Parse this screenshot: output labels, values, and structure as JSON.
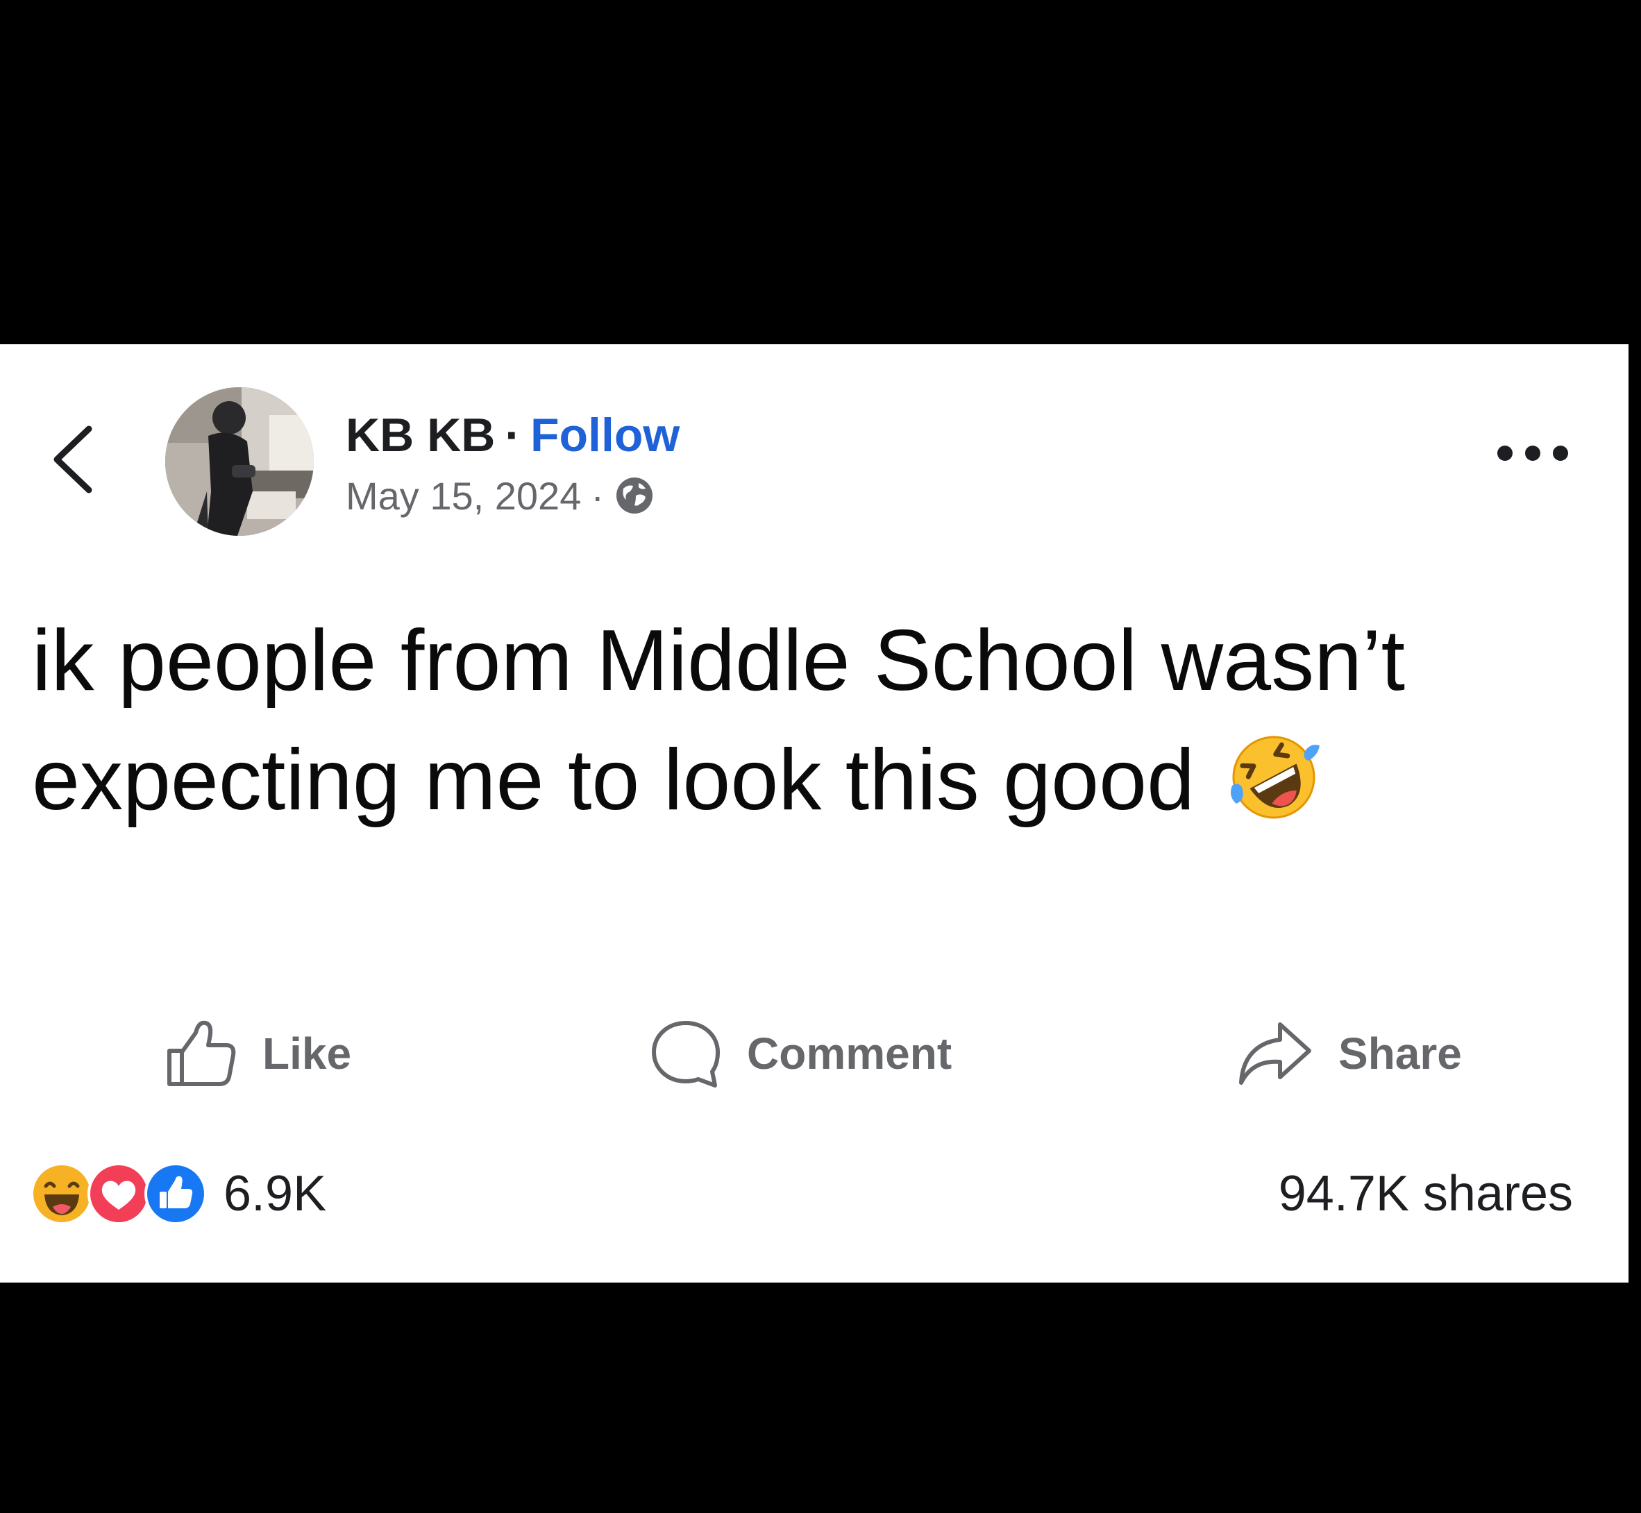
{
  "post": {
    "author_name": "KB KB",
    "author_separator": "·",
    "follow_label": "Follow",
    "date": "May 15, 2024",
    "date_separator": "·",
    "privacy_icon": "globe-icon",
    "text": "ik people from Middle School wasn’t expecting me to look this good",
    "emoji_icon": "rolling-on-floor-laughing-emoji"
  },
  "actions": {
    "like_label": "Like",
    "comment_label": "Comment",
    "share_label": "Share"
  },
  "stats": {
    "reaction_icons": [
      "haha-reaction-icon",
      "love-reaction-icon",
      "like-reaction-icon"
    ],
    "reaction_count": "6.9K",
    "shares_label": "94.7K shares"
  },
  "colors": {
    "follow_blue": "#1f62d8",
    "text_dark": "#1c1e21",
    "text_muted": "#65676b",
    "like_blue": "#1877f2",
    "love_red": "#f33e58",
    "haha_yellow": "#f7b125"
  }
}
